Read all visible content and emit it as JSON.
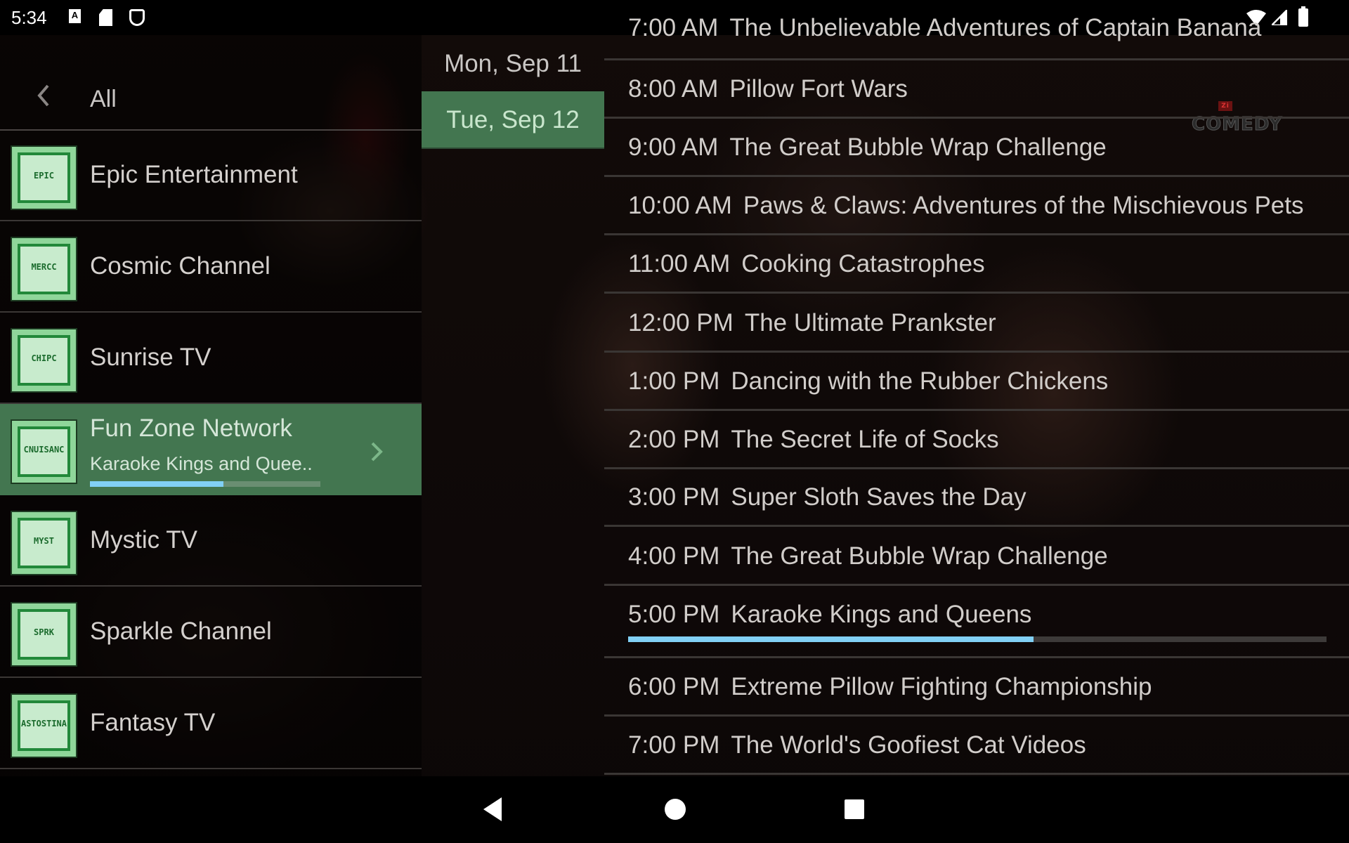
{
  "status_bar": {
    "time": "5:34",
    "left_icons": [
      "a-notification-icon",
      "sd-card-icon",
      "android-debug-icon"
    ],
    "right_icons": [
      "wifi-icon",
      "cell-signal-icon",
      "battery-icon"
    ]
  },
  "header": {
    "back_icon": "chevron-left-icon",
    "title": "All"
  },
  "channels": [
    {
      "name": "Epic Entertainment",
      "logo_text": "EPIC",
      "selected": false
    },
    {
      "name": "Cosmic Channel",
      "logo_text": "MERCC",
      "selected": false
    },
    {
      "name": "Sunrise TV",
      "logo_text": "CHIPC",
      "selected": false
    },
    {
      "name": "Fun Zone Network",
      "logo_text": "CNUISANC",
      "selected": true,
      "now_playing": "Karaoke Kings and Quee..",
      "progress": 0.58,
      "chevron_icon": "chevron-right-icon"
    },
    {
      "name": "Mystic TV",
      "logo_text": "MYST",
      "selected": false
    },
    {
      "name": "Sparkle Channel",
      "logo_text": "SPRK",
      "selected": false
    },
    {
      "name": "Fantasy TV",
      "logo_text": "ASTOSTINA",
      "selected": false
    }
  ],
  "dates": [
    {
      "label": "Mon, Sep 11",
      "selected": false
    },
    {
      "label": "Tue, Sep 12",
      "selected": true
    }
  ],
  "programs": [
    {
      "time": "7:00 AM",
      "title": "The Unbelievable Adventures of Captain Banana"
    },
    {
      "time": "8:00 AM",
      "title": "Pillow Fort Wars"
    },
    {
      "time": "9:00 AM",
      "title": "The Great Bubble Wrap Challenge"
    },
    {
      "time": "10:00 AM",
      "title": "Paws & Claws: Adventures of the Mischievous Pets"
    },
    {
      "time": "11:00 AM",
      "title": "Cooking Catastrophes"
    },
    {
      "time": "12:00 PM",
      "title": "The Ultimate Prankster"
    },
    {
      "time": "1:00 PM",
      "title": "Dancing with the Rubber Chickens"
    },
    {
      "time": "2:00 PM",
      "title": "The Secret Life of Socks"
    },
    {
      "time": "3:00 PM",
      "title": "Super Sloth Saves the Day"
    },
    {
      "time": "4:00 PM",
      "title": "The Great Bubble Wrap Challenge"
    },
    {
      "time": "5:00 PM",
      "title": "Karaoke Kings and Queens",
      "now": true,
      "progress": 0.58
    },
    {
      "time": "6:00 PM",
      "title": "Extreme Pillow Fighting Championship"
    },
    {
      "time": "7:00 PM",
      "title": "The World's Goofiest Cat Videos"
    }
  ],
  "video_watermark": {
    "badge": "Zi",
    "text": "COMEDY"
  },
  "nav_bar": {
    "back": "nav-back-icon",
    "home": "nav-home-icon",
    "recents": "nav-recents-icon"
  },
  "colors": {
    "accent_green": "#437650",
    "progress_blue": "#81d0f5"
  }
}
